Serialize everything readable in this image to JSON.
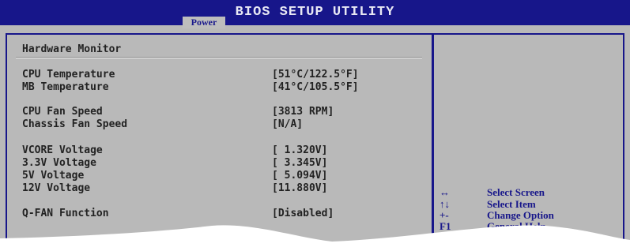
{
  "header": {
    "title": "BIOS SETUP UTILITY",
    "active_tab": "Power"
  },
  "page": {
    "title": "Hardware Monitor"
  },
  "items": [
    {
      "label": "CPU Temperature",
      "value": "[51°C/122.5°F]"
    },
    {
      "label": "MB Temperature",
      "value": "[41°C/105.5°F]"
    },
    {
      "label": "CPU Fan Speed",
      "value": "[3813 RPM]"
    },
    {
      "label": "Chassis Fan Speed",
      "value": "[N/A]"
    },
    {
      "label": "VCORE Voltage",
      "value": "[ 1.320V]"
    },
    {
      "label": "3.3V Voltage",
      "value": "[ 3.345V]"
    },
    {
      "label": "5V Voltage",
      "value": "[ 5.094V]"
    },
    {
      "label": "12V Voltage",
      "value": "[11.880V]"
    },
    {
      "label": "Q-FAN Function",
      "value": "[Disabled]"
    }
  ],
  "help": [
    {
      "key": "↔",
      "action": "Select Screen"
    },
    {
      "key": "↑↓",
      "action": "Select Item"
    },
    {
      "key": "+-",
      "action": "Change Option"
    },
    {
      "key": "F1",
      "action": "General Help"
    }
  ],
  "colors": {
    "title_bar": "#17168a",
    "panel": "#b9b9b9",
    "help_text": "#17168a"
  }
}
